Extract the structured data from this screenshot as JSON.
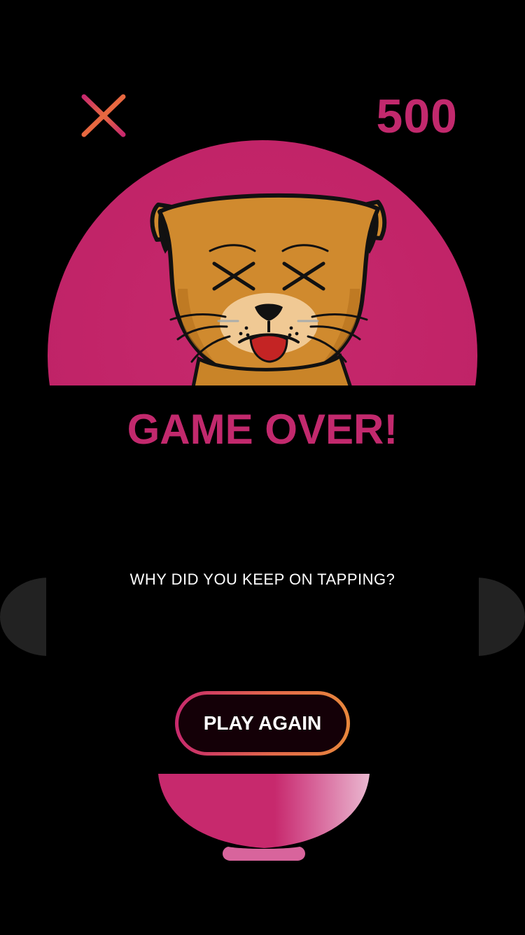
{
  "score": "500",
  "title": "GAME OVER!",
  "subtitle": "WHY DID YOU KEEP ON TAPPING?",
  "play_again_label": "PLAY AGAIN",
  "icons": {
    "close": "close-icon",
    "cat": "dead-cat-face-icon",
    "bowl": "bowl-icon"
  },
  "colors": {
    "accent_pink": "#c2296d",
    "button_border_gradient": [
      "#c7296d",
      "#e8873c"
    ],
    "background": "#000000",
    "cat_fur": "#d08a2e"
  }
}
